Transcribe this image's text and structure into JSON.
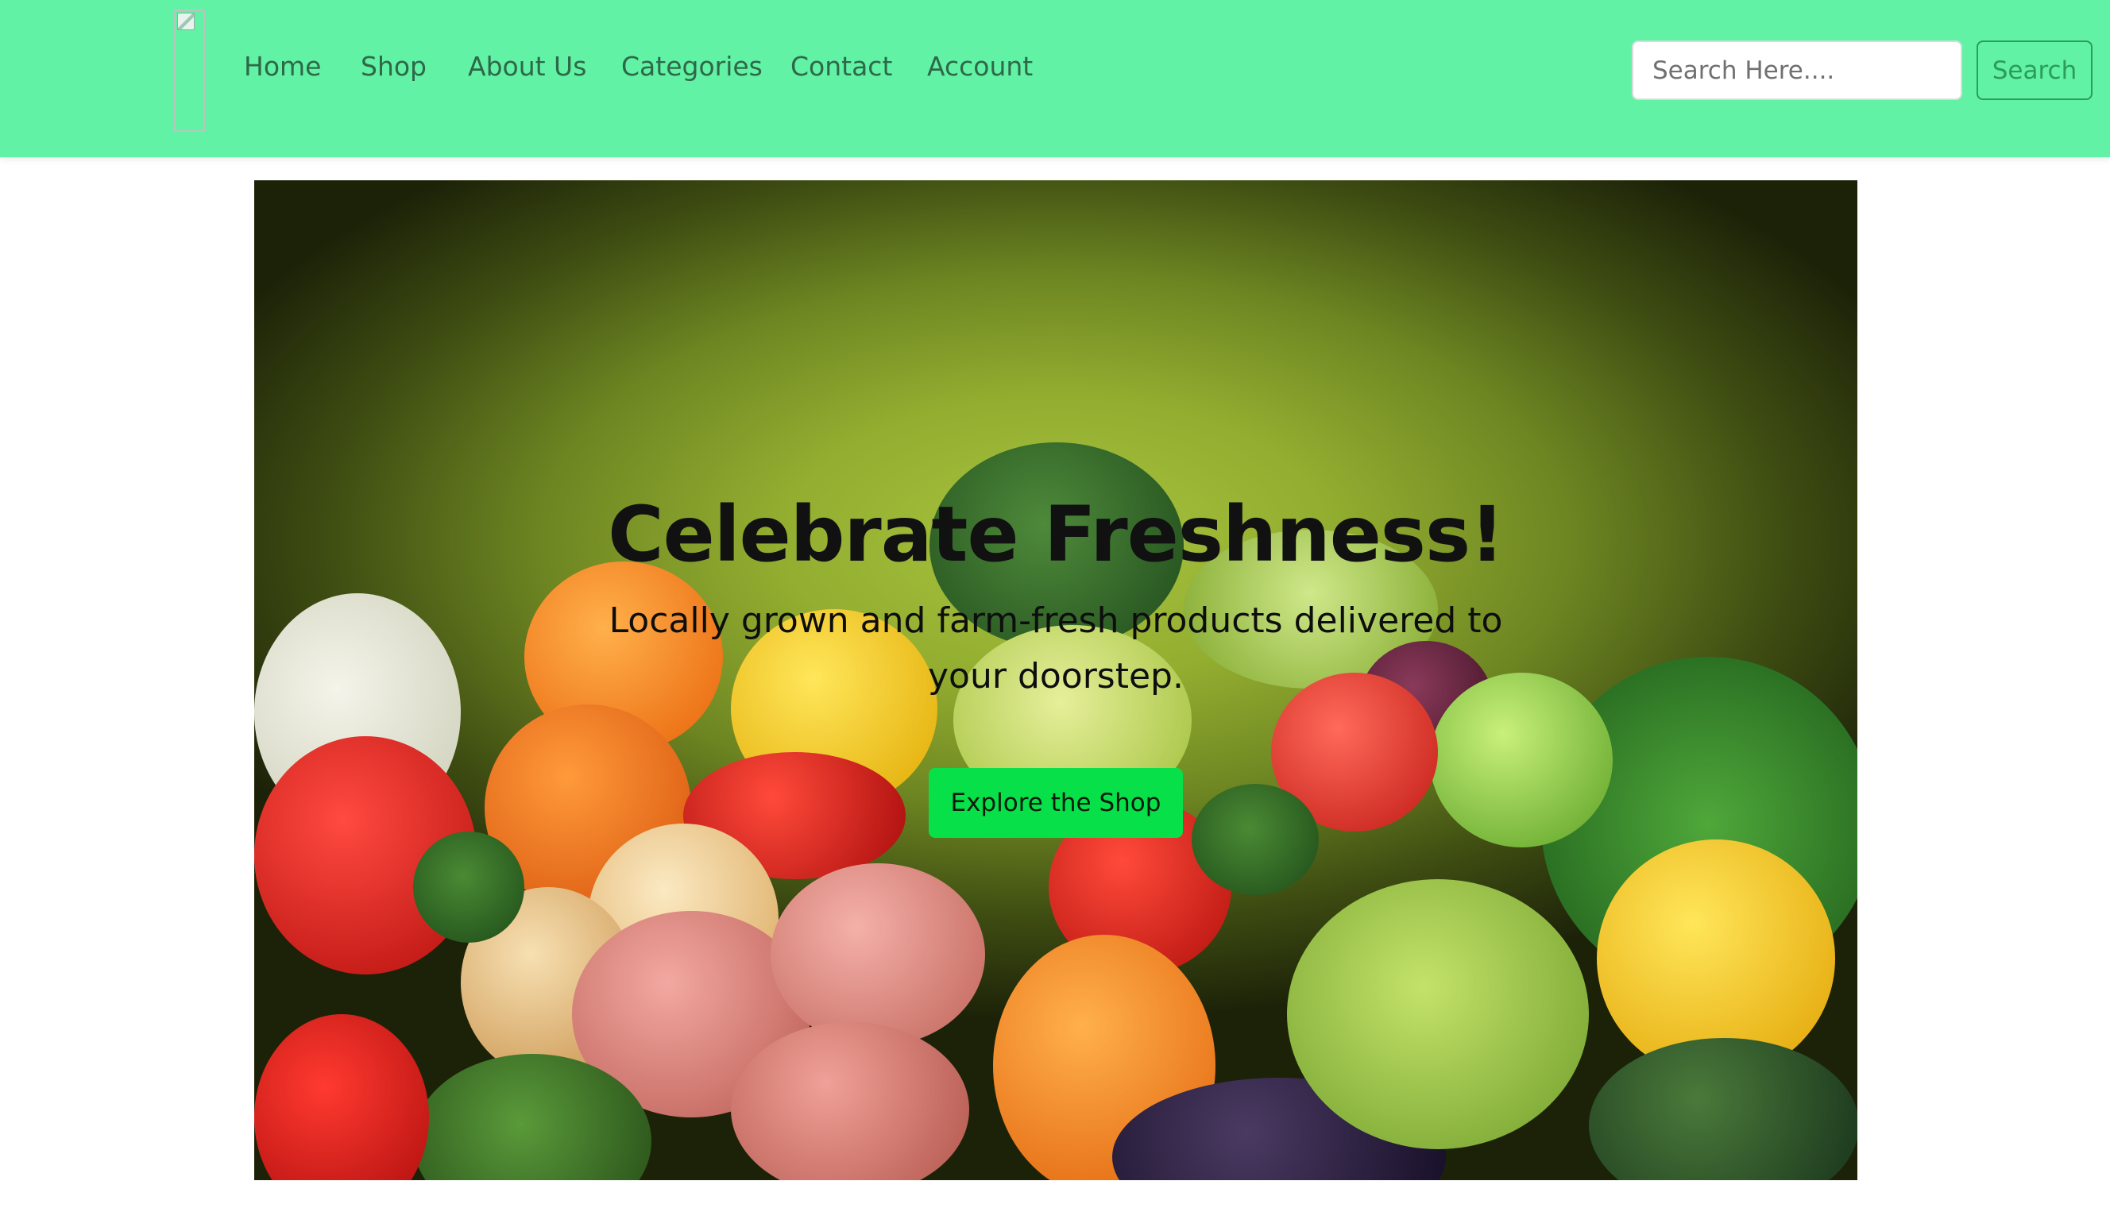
{
  "nav": {
    "logo_icon": "broken-image-icon",
    "links": [
      "Home",
      "Shop",
      "About Us",
      "Categories",
      "Contact",
      "Account"
    ],
    "search_placeholder": "Search Here....",
    "search_button": "Search"
  },
  "hero": {
    "title": "Celebrate Freshness!",
    "subtitle": "Locally grown and farm-fresh products delivered to your doorstep.",
    "cta": "Explore the Shop"
  },
  "colors": {
    "navbar": "#61f2a5",
    "nav_text": "#2e6848",
    "search_button": "#2c9c57",
    "cta": "#08e04a"
  }
}
